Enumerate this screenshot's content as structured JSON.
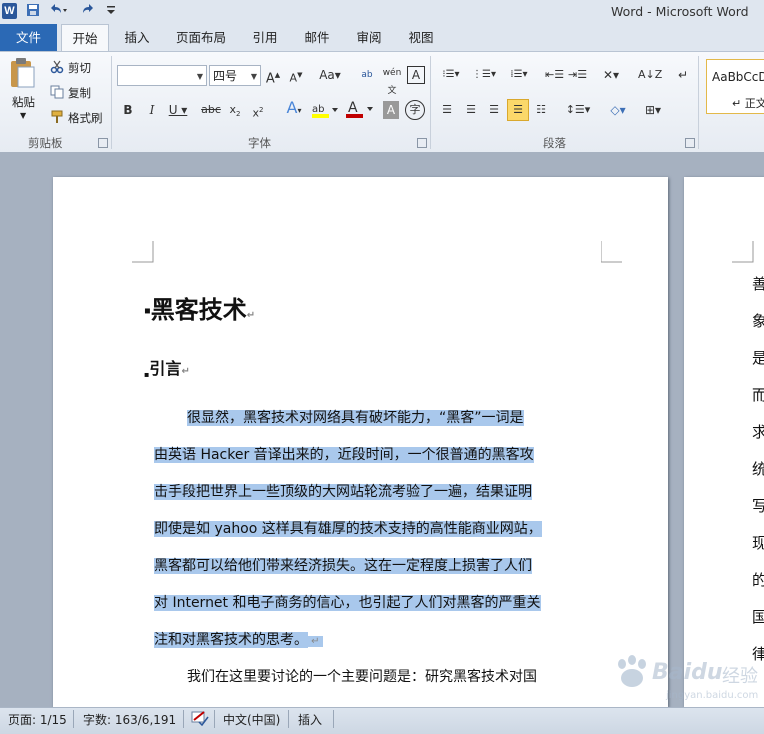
{
  "window": {
    "title": "Word - Microsoft Word"
  },
  "tabs": [
    "文件",
    "开始",
    "插入",
    "页面布局",
    "引用",
    "邮件",
    "审阅",
    "视图"
  ],
  "clipboard": {
    "paste": "粘贴",
    "cut": "剪切",
    "copy": "复制",
    "format_painter": "格式刷",
    "group": "剪贴板"
  },
  "font": {
    "name_value": "",
    "size_value": "四号",
    "group": "字体",
    "font_color": "#c00000",
    "highlight_color": "#ffff00"
  },
  "paragraph": {
    "group": "段落"
  },
  "styles": {
    "preview": "AaBbCcD",
    "normal": "↵ 正文"
  },
  "document": {
    "title": "黑客技术",
    "heading": "引言",
    "para1_lines": [
      "很显然，黑客技术对网络具有破坏能力，“黑客”一词是",
      "由英语 Hacker 音译出来的，近段时间，一个很普通的黑客攻",
      "击手段把世界上一些顶级的大网站轮流考验了一遍，结果证明",
      "即使是如 yahoo 这样具有雄厚的技术支持的高性能商业网站，",
      "黑客都可以给他们带来经济损失。这在一定程度上损害了人们",
      "对 Internet 和电子商务的信心，也引起了人们对黑客的严重关",
      "注和对黑客技术的思考。"
    ],
    "para2_line": "我们在这里要讨论的一个主要问题是：研究黑客技术对国",
    "page2_chars": [
      "善",
      "象",
      "是",
      "而",
      "求",
      "统",
      "写",
      "现",
      "的",
      "国",
      "律"
    ],
    "selection_color": "#a9c8ec"
  },
  "status": {
    "page": "页面: 1/15",
    "words": "字数: 163/6,191",
    "language": "中文(中国)",
    "mode": "插入"
  },
  "watermark": {
    "brand": "Baidu",
    "brand_cn": "经验",
    "url": "jingyan.baidu.com"
  }
}
